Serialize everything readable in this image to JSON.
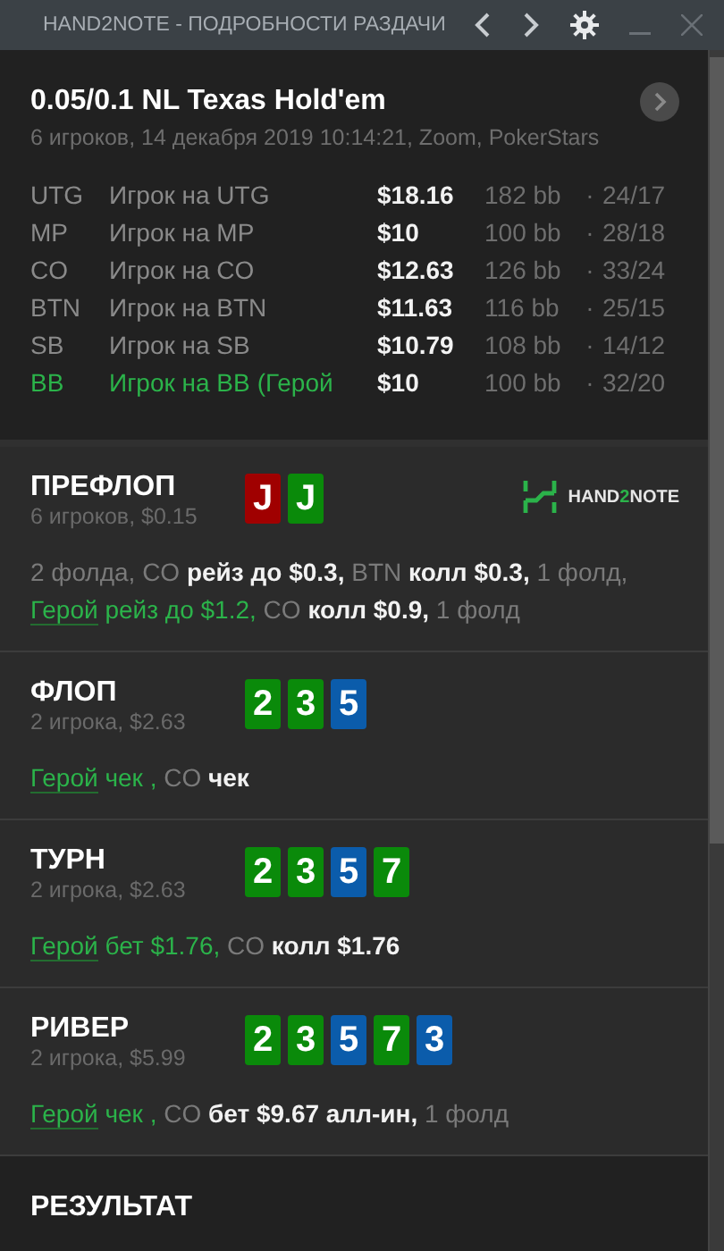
{
  "window": {
    "title": "HAND2NOTE - ПОДРОБНОСТИ РАЗДАЧИ"
  },
  "hand": {
    "title": "0.05/0.1 NL Texas Hold'em",
    "subtitle": "6 игроков, 14 декабря 2019 10:14:21, Zoom, PokerStars"
  },
  "players": [
    {
      "position": "UTG",
      "name": "Игрок на UTG",
      "stack": "$18.16",
      "bb": "182 bb",
      "separator": "·",
      "stats": "24/17",
      "hero": false
    },
    {
      "position": "MP",
      "name": "Игрок на MP",
      "stack": "$10",
      "bb": "100 bb",
      "separator": "·",
      "stats": "28/18",
      "hero": false
    },
    {
      "position": "CO",
      "name": "Игрок на CO",
      "stack": "$12.63",
      "bb": "126 bb",
      "separator": "·",
      "stats": "33/24",
      "hero": false
    },
    {
      "position": "BTN",
      "name": "Игрок на BTN",
      "stack": "$11.63",
      "bb": "116 bb",
      "separator": "·",
      "stats": "25/15",
      "hero": false
    },
    {
      "position": "SB",
      "name": "Игрок на SB",
      "stack": "$10.79",
      "bb": "108 bb",
      "separator": "·",
      "stats": "14/12",
      "hero": false
    },
    {
      "position": "BB",
      "name": "Игрок на BB",
      "tag": "(Герой",
      "stack": "$10",
      "bb": "100 bb",
      "separator": "·",
      "stats": "32/20",
      "hero": true
    }
  ],
  "streets": [
    {
      "name": "ПРЕФЛОП",
      "info": "6 игроков, $0.15",
      "cards": [
        {
          "rank": "J",
          "color": "#a00000"
        },
        {
          "rank": "J",
          "color": "#0a8a0a"
        }
      ],
      "logo": {
        "before": "HAND",
        "accent": "2",
        "after": "NOTE"
      },
      "actions": [
        {
          "kind": "muted",
          "text": "2 фолда, CO"
        },
        {
          "kind": "bright",
          "text": "рейз до $0.3,"
        },
        {
          "kind": "muted",
          "text": "BTN"
        },
        {
          "kind": "bright",
          "text": "колл $0.3,"
        },
        {
          "kind": "muted",
          "text": "1 фолд,"
        },
        {
          "kind": "hero",
          "text": "Герой"
        },
        {
          "kind": "hero_action",
          "text": "рейз до $1.2,"
        },
        {
          "kind": "muted",
          "text": "CO"
        },
        {
          "kind": "bright",
          "text": "колл $0.9,"
        },
        {
          "kind": "muted",
          "text": "1 фолд"
        }
      ]
    },
    {
      "name": "ФЛОП",
      "info": "2 игрока, $2.63",
      "cards": [
        {
          "rank": "2",
          "color": "#0a8a0a"
        },
        {
          "rank": "3",
          "color": "#0a8a0a"
        },
        {
          "rank": "5",
          "color": "#0b5cab"
        }
      ],
      "actions": [
        {
          "kind": "hero",
          "text": "Герой"
        },
        {
          "kind": "hero_action",
          "text": "чек ,"
        },
        {
          "kind": "muted",
          "text": "CO"
        },
        {
          "kind": "bright",
          "text": "чек"
        }
      ]
    },
    {
      "name": "ТУРН",
      "info": "2 игрока, $2.63",
      "cards": [
        {
          "rank": "2",
          "color": "#0a8a0a"
        },
        {
          "rank": "3",
          "color": "#0a8a0a"
        },
        {
          "rank": "5",
          "color": "#0b5cab"
        },
        {
          "rank": "7",
          "color": "#0a8a0a"
        }
      ],
      "actions": [
        {
          "kind": "hero",
          "text": "Герой"
        },
        {
          "kind": "hero_action",
          "text": "бет $1.76,"
        },
        {
          "kind": "muted",
          "text": "CO"
        },
        {
          "kind": "bright",
          "text": "колл $1.76"
        }
      ]
    },
    {
      "name": "РИВЕР",
      "info": "2 игрока, $5.99",
      "cards": [
        {
          "rank": "2",
          "color": "#0a8a0a"
        },
        {
          "rank": "3",
          "color": "#0a8a0a"
        },
        {
          "rank": "5",
          "color": "#0b5cab"
        },
        {
          "rank": "7",
          "color": "#0a8a0a"
        },
        {
          "rank": "3",
          "color": "#0b5cab"
        }
      ],
      "actions": [
        {
          "kind": "hero",
          "text": "Герой"
        },
        {
          "kind": "hero_action",
          "text": "чек ,"
        },
        {
          "kind": "muted",
          "text": "CO"
        },
        {
          "kind": "bright",
          "text": "бет $9.67 алл-ин,"
        },
        {
          "kind": "muted",
          "text": "1 фолд"
        }
      ]
    }
  ],
  "result": {
    "title": "РЕЗУЛЬТАТ"
  }
}
